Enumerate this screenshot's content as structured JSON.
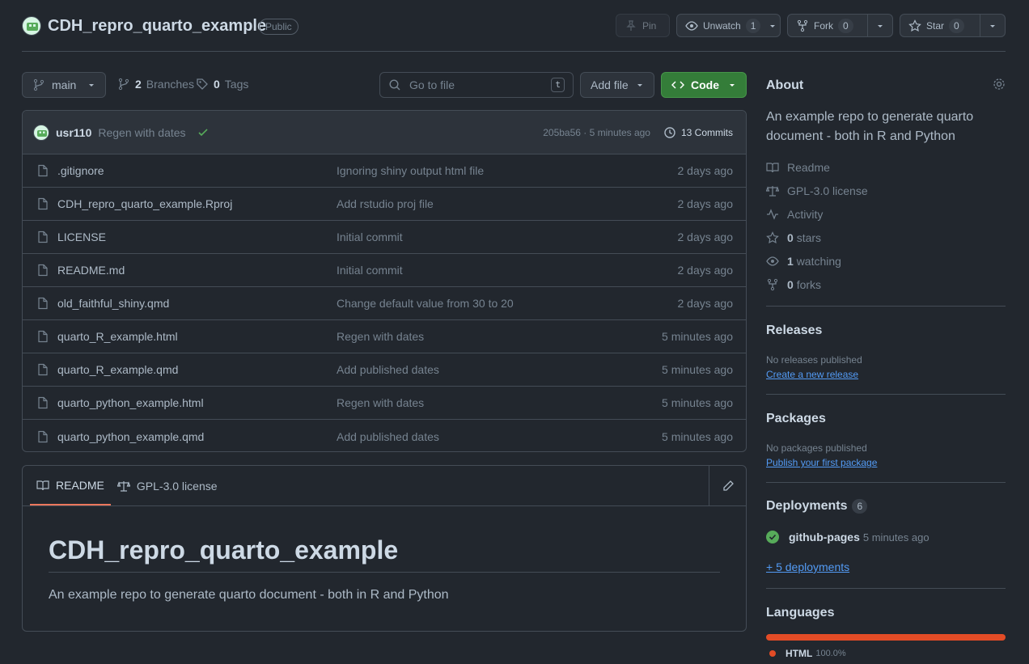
{
  "header": {
    "repo_name": "CDH_repro_quarto_example",
    "visibility": "Public",
    "pin_label": "Pin",
    "unwatch_label": "Unwatch",
    "watch_count": "1",
    "fork_label": "Fork",
    "fork_count": "0",
    "star_label": "Star",
    "star_count": "0"
  },
  "toolbar": {
    "branch": "main",
    "branches_count": "2",
    "branches_label": "Branches",
    "tags_count": "0",
    "tags_label": "Tags",
    "search_placeholder": "Go to file",
    "search_shortcut": "t",
    "add_file_label": "Add file",
    "code_label": "Code"
  },
  "latest_commit": {
    "user": "usr110",
    "message": "Regen with dates",
    "meta": "205ba56 · 5 minutes ago",
    "commits_label": "13 Commits"
  },
  "files": [
    {
      "name": ".gitignore",
      "message": "Ignoring shiny output html file",
      "time": "2 days ago"
    },
    {
      "name": "CDH_repro_quarto_example.Rproj",
      "message": "Add rstudio proj file",
      "time": "2 days ago"
    },
    {
      "name": "LICENSE",
      "message": "Initial commit",
      "time": "2 days ago"
    },
    {
      "name": "README.md",
      "message": "Initial commit",
      "time": "2 days ago"
    },
    {
      "name": "old_faithful_shiny.qmd",
      "message": "Change default value from 30 to 20",
      "time": "2 days ago"
    },
    {
      "name": "quarto_R_example.html",
      "message": "Regen with dates",
      "time": "5 minutes ago"
    },
    {
      "name": "quarto_R_example.qmd",
      "message": "Add published dates",
      "time": "5 minutes ago"
    },
    {
      "name": "quarto_python_example.html",
      "message": "Regen with dates",
      "time": "5 minutes ago"
    },
    {
      "name": "quarto_python_example.qmd",
      "message": "Add published dates",
      "time": "5 minutes ago"
    }
  ],
  "readme": {
    "tab_readme": "README",
    "tab_license": "GPL-3.0 license",
    "title": "CDH_repro_quarto_example",
    "text": "An example repo to generate quarto document - both in R and Python"
  },
  "sidebar": {
    "about_title": "About",
    "description": "An example repo to generate quarto document - both in R and Python",
    "readme": "Readme",
    "license": "GPL-3.0 license",
    "activity": "Activity",
    "stars_count": "0",
    "stars_label": "stars",
    "watching_count": "1",
    "watching_label": "watching",
    "forks_count": "0",
    "forks_label": "forks",
    "releases_title": "Releases",
    "releases_empty": "No releases published",
    "releases_link": "Create a new release",
    "packages_title": "Packages",
    "packages_empty": "No packages published",
    "packages_link": "Publish your first package",
    "deployments_title": "Deployments",
    "deployments_count": "6",
    "deployment_name": "github-pages",
    "deployment_time": "5 minutes ago",
    "deployments_more": "+ 5 deployments",
    "languages_title": "Languages",
    "language_name": "HTML",
    "language_percent": "100.0%"
  },
  "colors": {
    "background": "#22272e",
    "code_button": "#347d39",
    "html_language": "#e34c26",
    "link": "#539bf5",
    "active_tab": "#ec775c"
  }
}
